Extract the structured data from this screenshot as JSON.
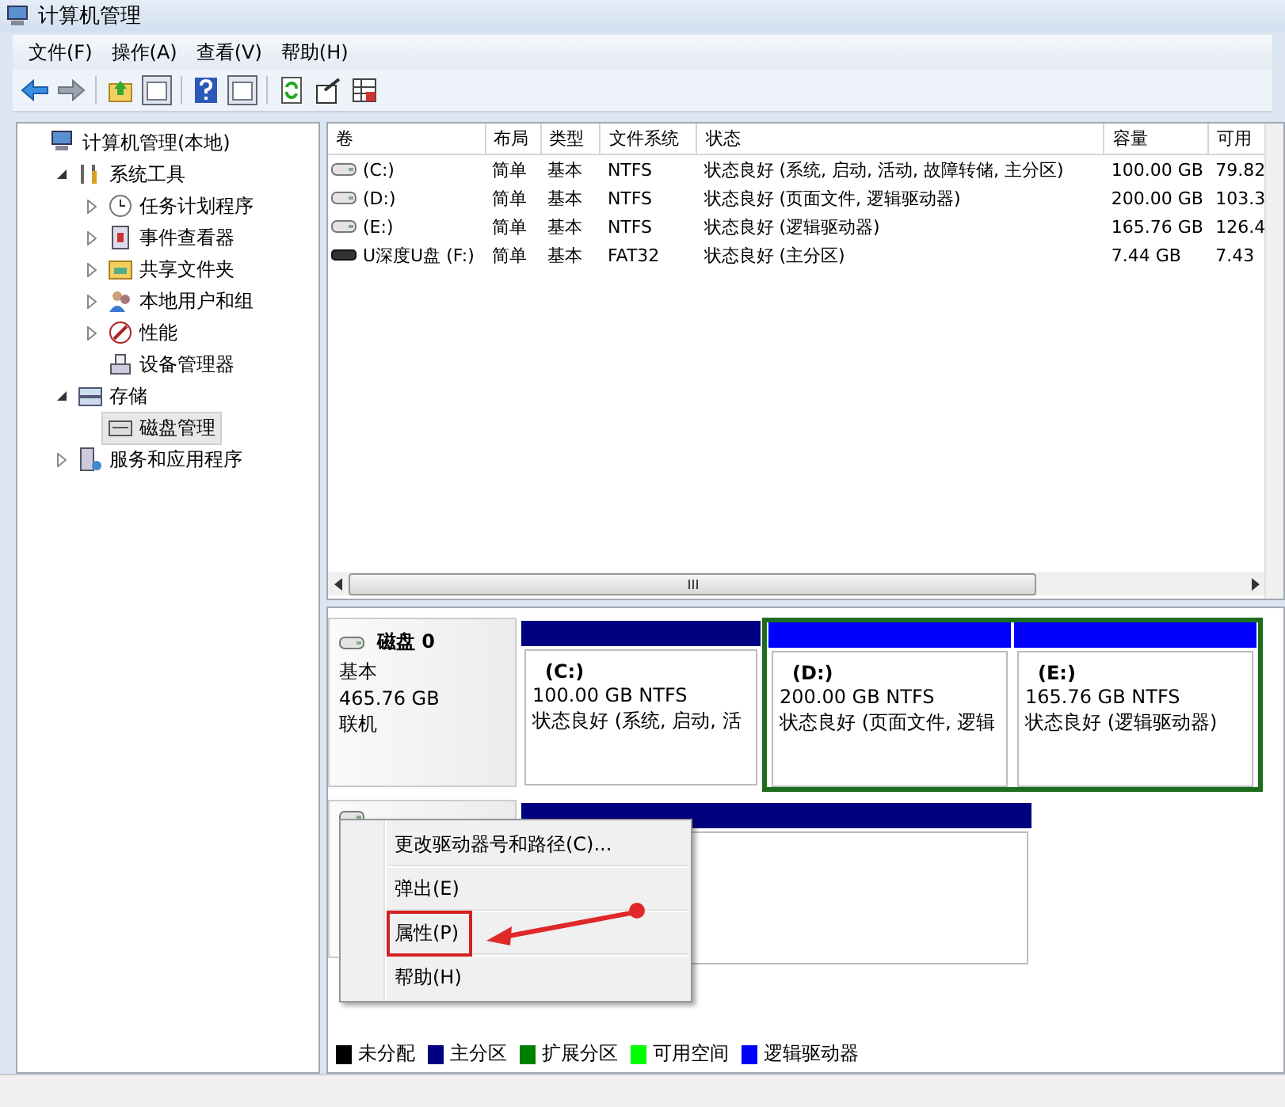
{
  "window": {
    "title": "计算机管理"
  },
  "menu": [
    "文件(F)",
    "操作(A)",
    "查看(V)",
    "帮助(H)"
  ],
  "tree": [
    {
      "label": "计算机管理(本地)",
      "selected": false,
      "children": [
        {
          "label": "系统工具",
          "expanded": true,
          "selected": false,
          "children": [
            {
              "label": "任务计划程序",
              "expanded": false,
              "selected": false
            },
            {
              "label": "事件查看器",
              "expanded": false,
              "selected": false
            },
            {
              "label": "共享文件夹",
              "expanded": false,
              "selected": false
            },
            {
              "label": "本地用户和组",
              "expanded": false,
              "selected": false
            },
            {
              "label": "性能",
              "expanded": false,
              "selected": false
            },
            {
              "label": "设备管理器",
              "selected": false
            }
          ]
        },
        {
          "label": "存储",
          "expanded": true,
          "selected": false,
          "children": [
            {
              "label": "磁盘管理",
              "selected": true
            }
          ]
        },
        {
          "label": "服务和应用程序",
          "expanded": false,
          "selected": false
        }
      ]
    }
  ],
  "table": {
    "columns": [
      "卷",
      "布局",
      "类型",
      "文件系统",
      "状态",
      "容量",
      "可用"
    ],
    "rows": [
      {
        "kind": "fixed",
        "cells": [
          "(C:)",
          "简单",
          "基本",
          "NTFS",
          "状态良好 (系统, 启动, 活动, 故障转储, 主分区)",
          "100.00 GB",
          "79.82"
        ]
      },
      {
        "kind": "fixed",
        "cells": [
          "(D:)",
          "简单",
          "基本",
          "NTFS",
          "状态良好 (页面文件, 逻辑驱动器)",
          "200.00 GB",
          "103.3"
        ]
      },
      {
        "kind": "fixed",
        "cells": [
          "(E:)",
          "简单",
          "基本",
          "NTFS",
          "状态良好 (逻辑驱动器)",
          "165.76 GB",
          "126.4"
        ]
      },
      {
        "kind": "removable",
        "cells": [
          "U深度U盘 (F:)",
          "简单",
          "基本",
          "FAT32",
          "状态良好 (主分区)",
          "7.44 GB",
          "7.43"
        ]
      }
    ]
  },
  "disks": [
    {
      "name": "磁盘 0",
      "type": "基本",
      "size": "465.76 GB",
      "status": "联机",
      "partitions": [
        {
          "kind": "primary",
          "color": "#000080",
          "label": "(C:)",
          "size": "100.00 GB NTFS",
          "status": "状态良好 (系统, 启动, 活"
        },
        {
          "kind": "logical",
          "color": "#0000ff",
          "label": "(D:)",
          "size": "200.00 GB NTFS",
          "status": "状态良好 (页面文件, 逻辑"
        },
        {
          "kind": "logical",
          "color": "#0000ff",
          "label": "(E:)",
          "size": "165.76 GB NTFS",
          "status": "状态良好 (逻辑驱动器)"
        }
      ]
    },
    {
      "partitions": [
        {
          "kind": "primary",
          "color": "#000080"
        }
      ]
    }
  ],
  "context_menu": [
    {
      "label": "更改驱动器号和路径(C)...",
      "highlighted": false
    },
    {
      "label": "弹出(E)",
      "highlighted": false
    },
    {
      "label": "属性(P)",
      "highlighted": true
    },
    {
      "label": "帮助(H)",
      "highlighted": false
    }
  ],
  "legend": [
    {
      "label": "未分配",
      "color": "#000000"
    },
    {
      "label": "主分区",
      "color": "#000080"
    },
    {
      "label": "扩展分区",
      "color": "#008000"
    },
    {
      "label": "可用空间",
      "color": "#00ff00"
    },
    {
      "label": "逻辑驱动器",
      "color": "#0000ff"
    }
  ]
}
